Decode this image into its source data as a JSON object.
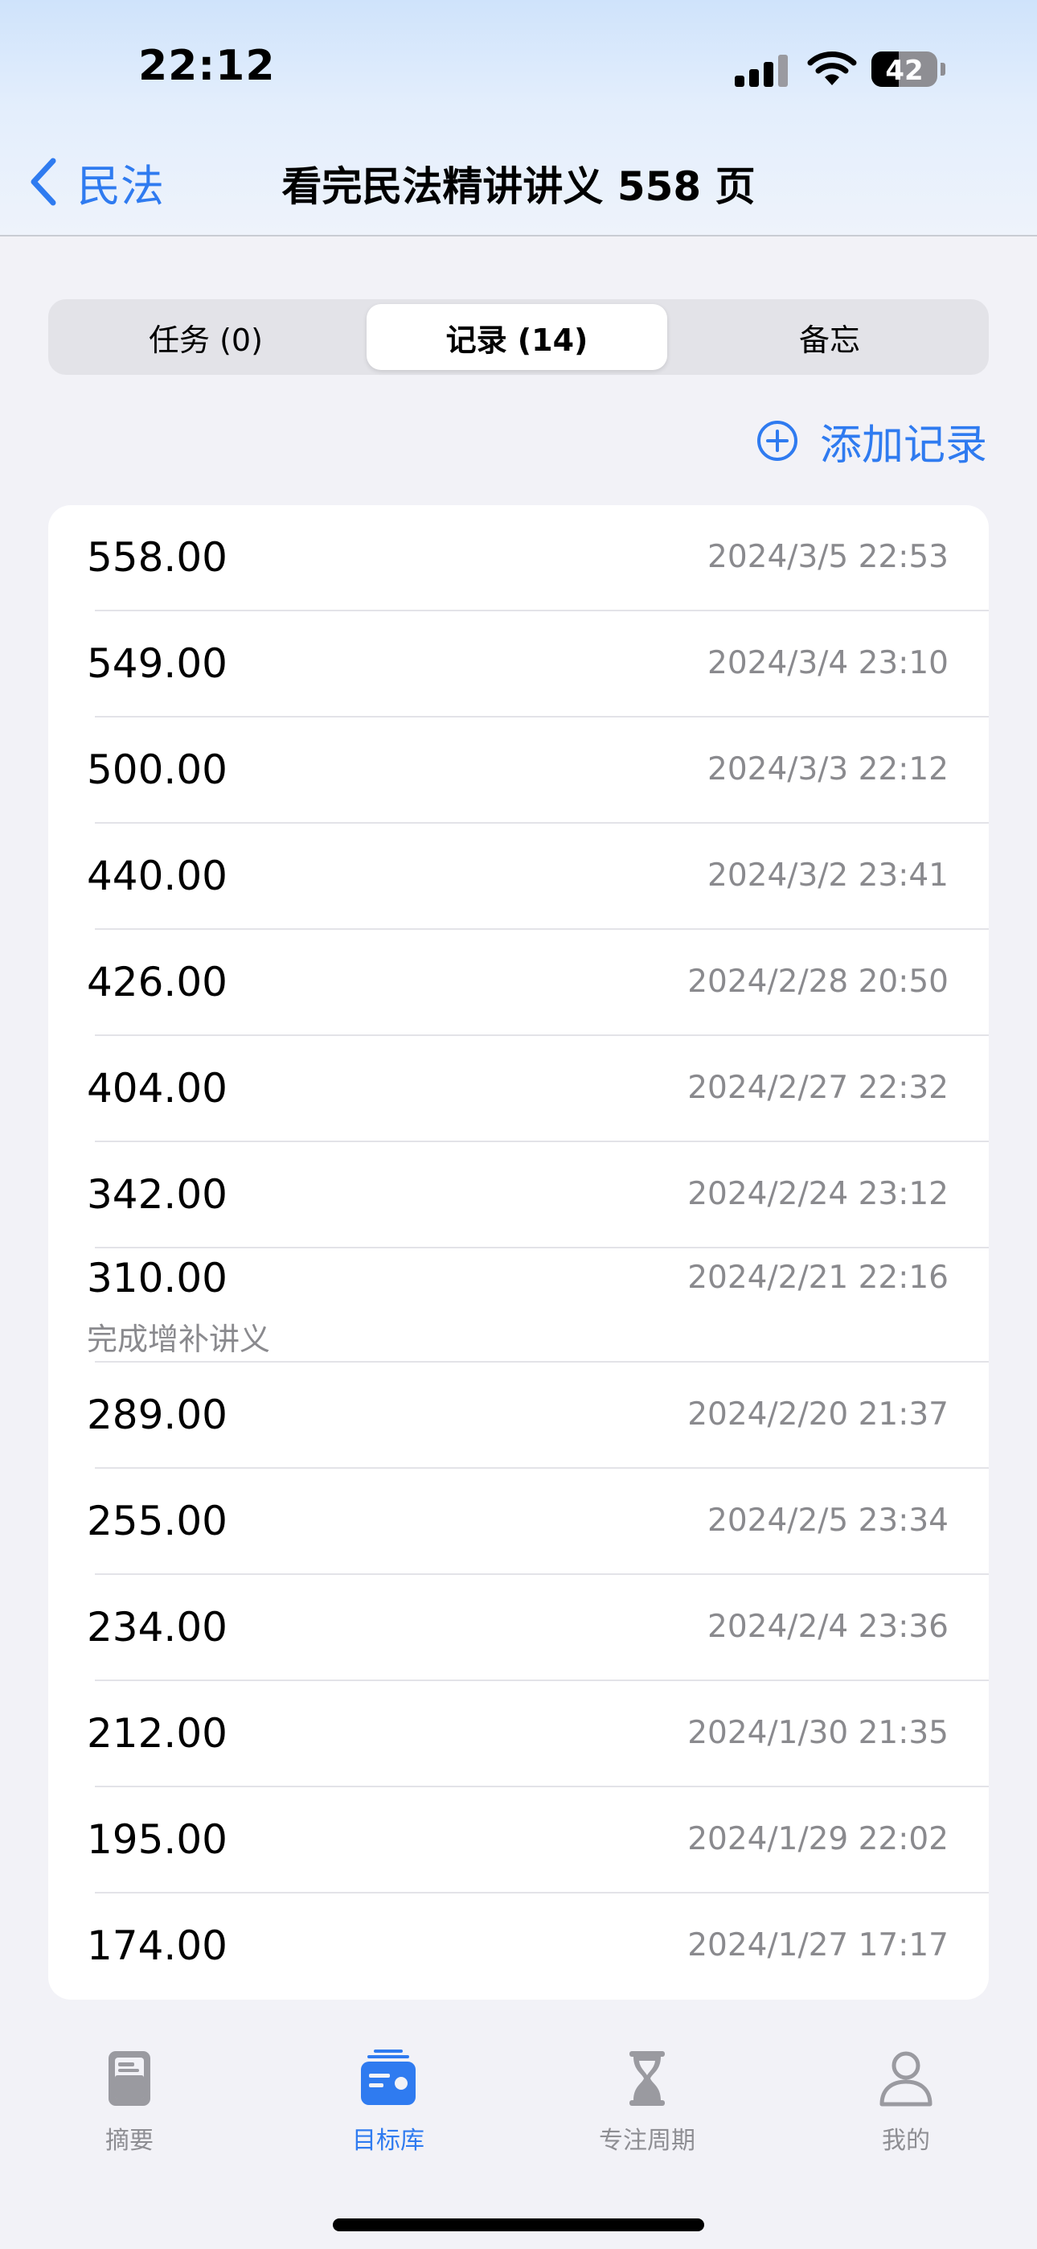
{
  "status_bar": {
    "time": "22:12",
    "battery_level": "42",
    "battery_fraction": 0.42
  },
  "nav": {
    "back_label": "民法",
    "title": "看完民法精讲讲义 558 页"
  },
  "segments": [
    {
      "label": "任务 (0)",
      "selected": false
    },
    {
      "label": "记录 (14)",
      "selected": true
    },
    {
      "label": "备忘",
      "selected": false
    }
  ],
  "add_record_label": "添加记录",
  "records": [
    {
      "value": "558.00",
      "date": "2024/3/5 22:53"
    },
    {
      "value": "549.00",
      "date": "2024/3/4 23:10"
    },
    {
      "value": "500.00",
      "date": "2024/3/3 22:12"
    },
    {
      "value": "440.00",
      "date": "2024/3/2 23:41"
    },
    {
      "value": "426.00",
      "date": "2024/2/28 20:50"
    },
    {
      "value": "404.00",
      "date": "2024/2/27 22:32"
    },
    {
      "value": "342.00",
      "date": "2024/2/24 23:12"
    },
    {
      "value": "310.00",
      "date": "2024/2/21 22:16",
      "note": "完成增补讲义"
    },
    {
      "value": "289.00",
      "date": "2024/2/20 21:37"
    },
    {
      "value": "255.00",
      "date": "2024/2/5 23:34"
    },
    {
      "value": "234.00",
      "date": "2024/2/4 23:36"
    },
    {
      "value": "212.00",
      "date": "2024/1/30 21:35"
    },
    {
      "value": "195.00",
      "date": "2024/1/29 22:02"
    },
    {
      "value": "174.00",
      "date": "2024/1/27 17:17"
    }
  ],
  "tab_bar": [
    {
      "label": "摘要",
      "icon": "summary-icon",
      "active": false
    },
    {
      "label": "目标库",
      "icon": "goal-library-icon",
      "active": true
    },
    {
      "label": "专注周期",
      "icon": "hourglass-icon",
      "active": false
    },
    {
      "label": "我的",
      "icon": "person-icon",
      "active": false
    }
  ],
  "colors": {
    "accent": "#2f7bf0",
    "secondary_text": "#8a8a8e",
    "background": "#f2f2f7"
  }
}
